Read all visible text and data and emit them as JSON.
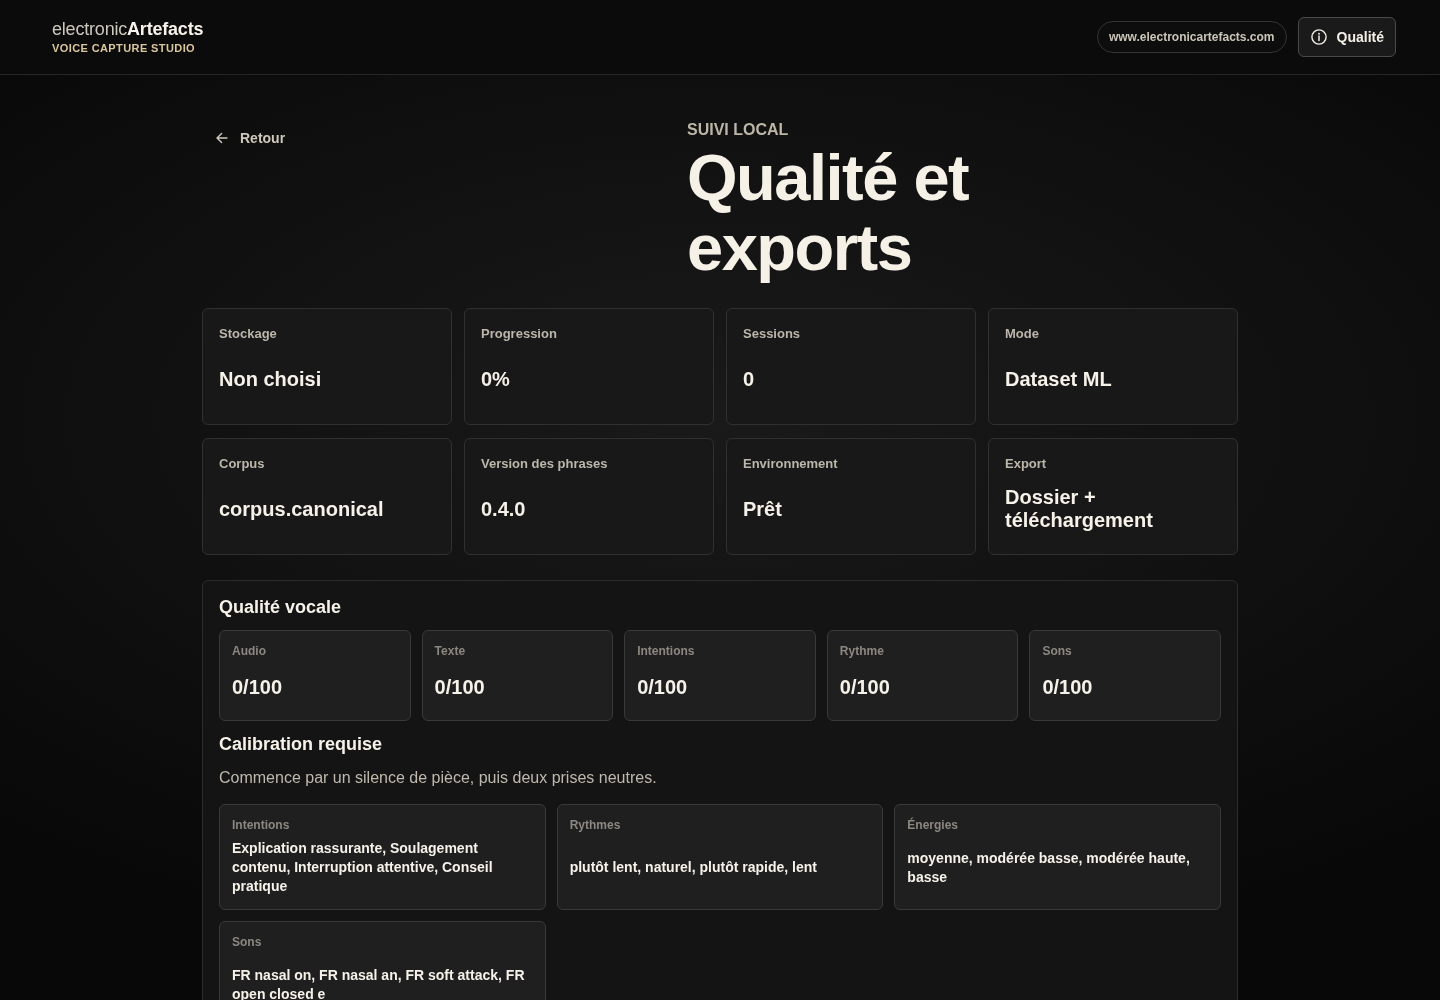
{
  "header": {
    "logo": "electronic**Artefacts**",
    "tagline": "VOICE CAPTURE STUDIO",
    "url": "www.electronicartefacts.com",
    "quality_button": "Qualité"
  },
  "back_link": "Retour",
  "hero": {
    "eyebrow": "SUIVI LOCAL",
    "title": "Qualité et exports"
  },
  "stats": [
    {
      "label": "Stockage",
      "value": "Non choisi"
    },
    {
      "label": "Progression",
      "value": "0%"
    },
    {
      "label": "Sessions",
      "value": "0"
    },
    {
      "label": "Mode",
      "value": "Dataset ML"
    },
    {
      "label": "Corpus",
      "value": "corpus.canonical"
    },
    {
      "label": "Version des phrases",
      "value": "0.4.0"
    },
    {
      "label": "Environnement",
      "value": "Prêt"
    },
    {
      "label": "Export",
      "value": "Dossier + téléchargement"
    }
  ],
  "quality_panel": {
    "title": "Qualité vocale",
    "scores": [
      {
        "label": "Audio",
        "value": "0/100"
      },
      {
        "label": "Texte",
        "value": "0/100"
      },
      {
        "label": "Intentions",
        "value": "0/100"
      },
      {
        "label": "Rythme",
        "value": "0/100"
      },
      {
        "label": "Sons",
        "value": "0/100"
      }
    ],
    "calibration": {
      "title": "Calibration requise",
      "text": "Commence par un silence de pièce, puis deux prises neutres."
    },
    "details": [
      {
        "label": "Intentions",
        "value": "Explication rassurante, Soulagement contenu, Interruption attentive, Conseil pratique"
      },
      {
        "label": "Rythmes",
        "value": "plutôt lent, naturel, plutôt rapide, lent"
      },
      {
        "label": "Énergies",
        "value": "moyenne, modérée basse, modérée haute, basse"
      },
      {
        "label": "Sons",
        "value": "FR nasal on, FR nasal an, FR soft attack, FR open closed e"
      }
    ]
  }
}
